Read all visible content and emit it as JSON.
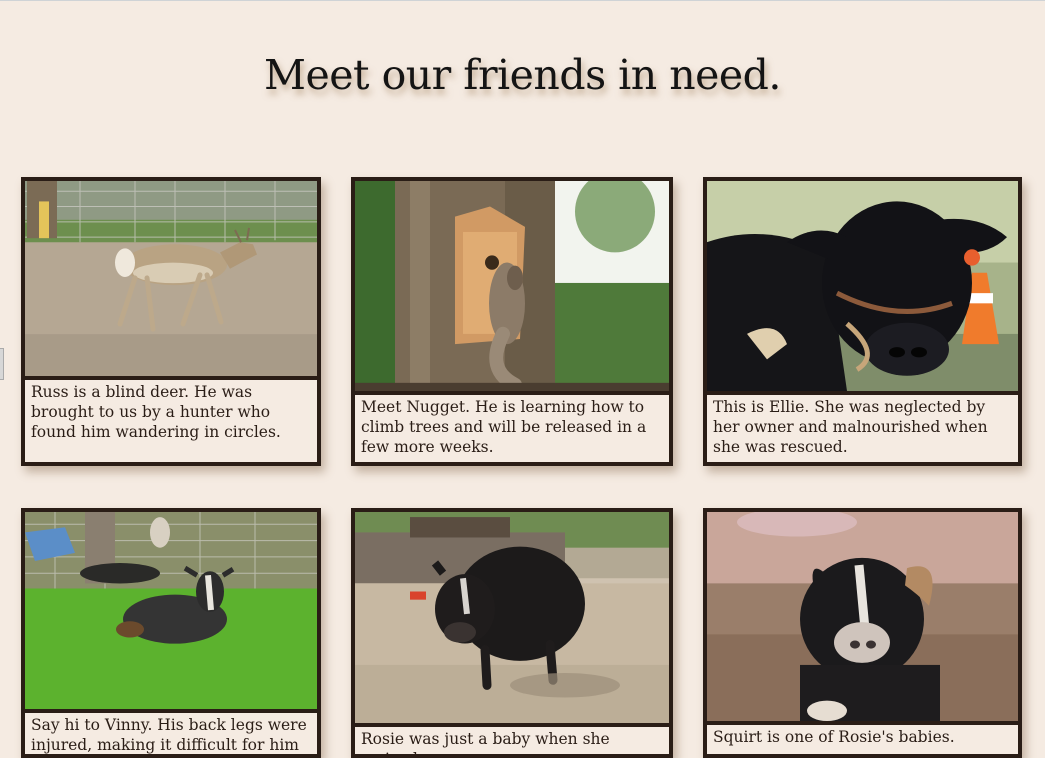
{
  "page": {
    "title": "Meet our friends in need."
  },
  "animals": [
    {
      "name": "Russ",
      "species": "deer",
      "caption": "Russ is a blind deer. He was brought to us by a hunter who found him wandering in circles."
    },
    {
      "name": "Nugget",
      "species": "squirrel",
      "caption": "Meet Nugget. He is learning how to climb trees and will be released in a few more weeks."
    },
    {
      "name": "Ellie",
      "species": "cow",
      "caption": "This is Ellie. She was neglected by her owner and malnourished when she was rescued."
    },
    {
      "name": "Vinny",
      "species": "goat",
      "caption": "Say hi to Vinny. His back legs were injured, making it difficult for him to"
    },
    {
      "name": "Rosie",
      "species": "pig",
      "caption": "Rosie was just a baby when she arrived."
    },
    {
      "name": "Squirt",
      "species": "piglet",
      "caption": "Squirt is one of Rosie's babies."
    }
  ]
}
